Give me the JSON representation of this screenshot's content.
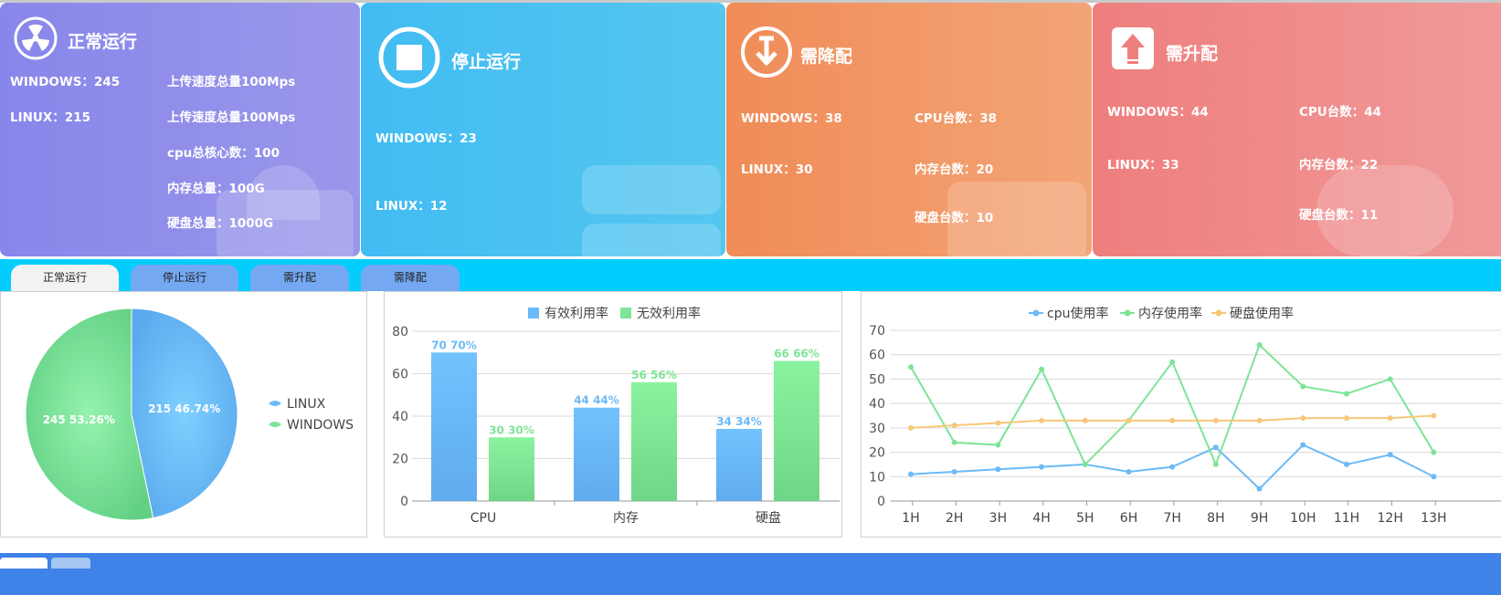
{
  "cards": [
    {
      "title": "正常运行",
      "icon": "radiation-icon",
      "lines_left": [
        "WINDOWS：245",
        "LINUX：215"
      ],
      "lines_right": [
        "上传速度总量100Mps",
        "上传速度总量100Mps",
        "cpu总核心数：100",
        "内存总量：100G",
        "硬盘总量：1000G"
      ]
    },
    {
      "title": "停止运行",
      "icon": "stop-icon",
      "lines_left": [
        "WINDOWS：23",
        "LINUX：12"
      ],
      "lines_right": []
    },
    {
      "title": "需降配",
      "icon": "download-arrow-icon",
      "lines_left": [
        "WINDOWS：38",
        "LINUX：30"
      ],
      "lines_right": [
        "CPU台数：38",
        "内存台数：20",
        "硬盘台数：10"
      ]
    },
    {
      "title": "需升配",
      "icon": "upload-arrow-icon",
      "lines_left": [
        "WINDOWS：44",
        "LINUX：33"
      ],
      "lines_right": [
        "CPU台数：44",
        "内存台数：22",
        "硬盘台数：11"
      ]
    }
  ],
  "tabs": [
    {
      "label": "正常运行",
      "active": true
    },
    {
      "label": "停止运行",
      "active": false
    },
    {
      "label": "需升配",
      "active": false
    },
    {
      "label": "需降配",
      "active": false
    }
  ],
  "colors": {
    "blue": "#6cbaf7",
    "green": "#7ee497",
    "orange": "#f8c77a"
  },
  "chart_data": [
    {
      "type": "pie",
      "labels": [
        "LINUX",
        "WINDOWS"
      ],
      "values": [
        215,
        245
      ],
      "percent_labels": [
        "215  46.74%",
        "245  53.26%"
      ],
      "legend_position": "right"
    },
    {
      "type": "bar",
      "categories": [
        "CPU",
        "内存",
        "硬盘"
      ],
      "series": [
        {
          "name": "有效利用率",
          "values": [
            70,
            44,
            34
          ],
          "labels": [
            "70  70%",
            "44  44%",
            "34  34%"
          ]
        },
        {
          "name": "无效利用率",
          "values": [
            30,
            56,
            66
          ],
          "labels": [
            "30  30%",
            "56  56%",
            "66  66%"
          ]
        }
      ],
      "ylim": [
        0,
        80
      ],
      "yticks": [
        "0",
        "20",
        "40",
        "60",
        "80"
      ],
      "grid": true,
      "legend_position": "top"
    },
    {
      "type": "line",
      "categories": [
        "1H",
        "2H",
        "3H",
        "4H",
        "5H",
        "6H",
        "7H",
        "8H",
        "9H",
        "10H",
        "11H",
        "12H",
        "13H"
      ],
      "series": [
        {
          "name": "cpu使用率",
          "values": [
            11,
            12,
            13,
            14,
            15,
            12,
            14,
            22,
            5,
            23,
            15,
            19,
            10
          ]
        },
        {
          "name": "内存使用率",
          "values": [
            55,
            24,
            23,
            54,
            15,
            33,
            57,
            15,
            64,
            47,
            44,
            50,
            20
          ]
        },
        {
          "name": "硬盘使用率",
          "values": [
            30,
            31,
            32,
            33,
            33,
            33,
            33,
            33,
            33,
            34,
            34,
            34,
            35
          ]
        }
      ],
      "ylim": [
        0,
        70
      ],
      "yticks": [
        "0",
        "10",
        "20",
        "30",
        "40",
        "50",
        "60",
        "70"
      ],
      "grid": true,
      "legend_position": "top"
    }
  ]
}
